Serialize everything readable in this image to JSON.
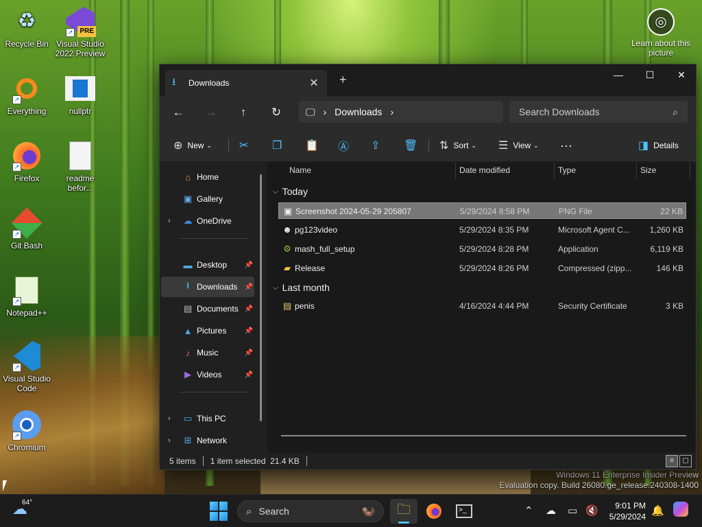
{
  "desktop": {
    "icons": [
      {
        "name": "recycle-bin",
        "label": "Recycle Bin",
        "glyph": "♻"
      },
      {
        "name": "visual-studio-2022-preview",
        "label": "Visual Studio 2022 Preview",
        "glyph": "PRE"
      },
      {
        "name": "everything",
        "label": "Everything",
        "glyph": "🔍"
      },
      {
        "name": "nullptr",
        "label": "nullptr",
        "glyph": "▮"
      },
      {
        "name": "firefox",
        "label": "Firefox",
        "glyph": "🦊"
      },
      {
        "name": "readme",
        "label": "readme befor...",
        "glyph": "📄"
      },
      {
        "name": "git-bash",
        "label": "Git Bash",
        "glyph": "◆"
      },
      {
        "name": "notepad-plus-plus",
        "label": "Notepad++",
        "glyph": "📝"
      },
      {
        "name": "visual-studio-code",
        "label": "Visual Studio Code",
        "glyph": "◀"
      },
      {
        "name": "chromium",
        "label": "Chromium",
        "glyph": "◉"
      }
    ],
    "learn_label": "Learn about this picture",
    "watermark_line1": "Windows 11 Enterprise Insider Preview",
    "watermark_line2": "Evaluation copy. Build 26080.ge_release.240308-1400"
  },
  "explorer": {
    "tab_title": "Downloads",
    "address_segment": "Downloads",
    "search_placeholder": "Search Downloads",
    "commands": {
      "new": "New",
      "sort": "Sort",
      "view": "View",
      "details": "Details"
    },
    "nav": {
      "home": "Home",
      "gallery": "Gallery",
      "onedrive": "OneDrive",
      "desktop": "Desktop",
      "downloads": "Downloads",
      "documents": "Documents",
      "pictures": "Pictures",
      "music": "Music",
      "videos": "Videos",
      "this_pc": "This PC",
      "network": "Network"
    },
    "columns": {
      "name": "Name",
      "date": "Date modified",
      "type": "Type",
      "size": "Size"
    },
    "groups": {
      "today": "Today",
      "last_month": "Last month"
    },
    "files": [
      {
        "name": "Screenshot 2024-05-29 205807",
        "date": "5/29/2024 8:58 PM",
        "type": "PNG File",
        "size": "22 KB",
        "icon": "image-file-icon"
      },
      {
        "name": "pg123video",
        "date": "5/29/2024 8:35 PM",
        "type": "Microsoft Agent C...",
        "size": "1,260 KB",
        "icon": "agent-file-icon"
      },
      {
        "name": "mash_full_setup",
        "date": "5/29/2024 8:28 PM",
        "type": "Application",
        "size": "6,119 KB",
        "icon": "application-icon"
      },
      {
        "name": "Release",
        "date": "5/29/2024 8:26 PM",
        "type": "Compressed (zipp...",
        "size": "146 KB",
        "icon": "zip-folder-icon"
      },
      {
        "name": "penis",
        "date": "4/16/2024 4:44 PM",
        "type": "Security Certificate",
        "size": "3 KB",
        "icon": "certificate-icon"
      }
    ],
    "status": {
      "count": "5 items",
      "selection": "1 item selected  21.4 KB"
    }
  },
  "taskbar": {
    "weather_temp": "64°",
    "search_label": "Search",
    "time": "9:01 PM",
    "date": "5/29/2024"
  },
  "colors": {
    "accent": "#4cc2ff",
    "window_bg": "#202020",
    "selected_row": "#777777"
  }
}
